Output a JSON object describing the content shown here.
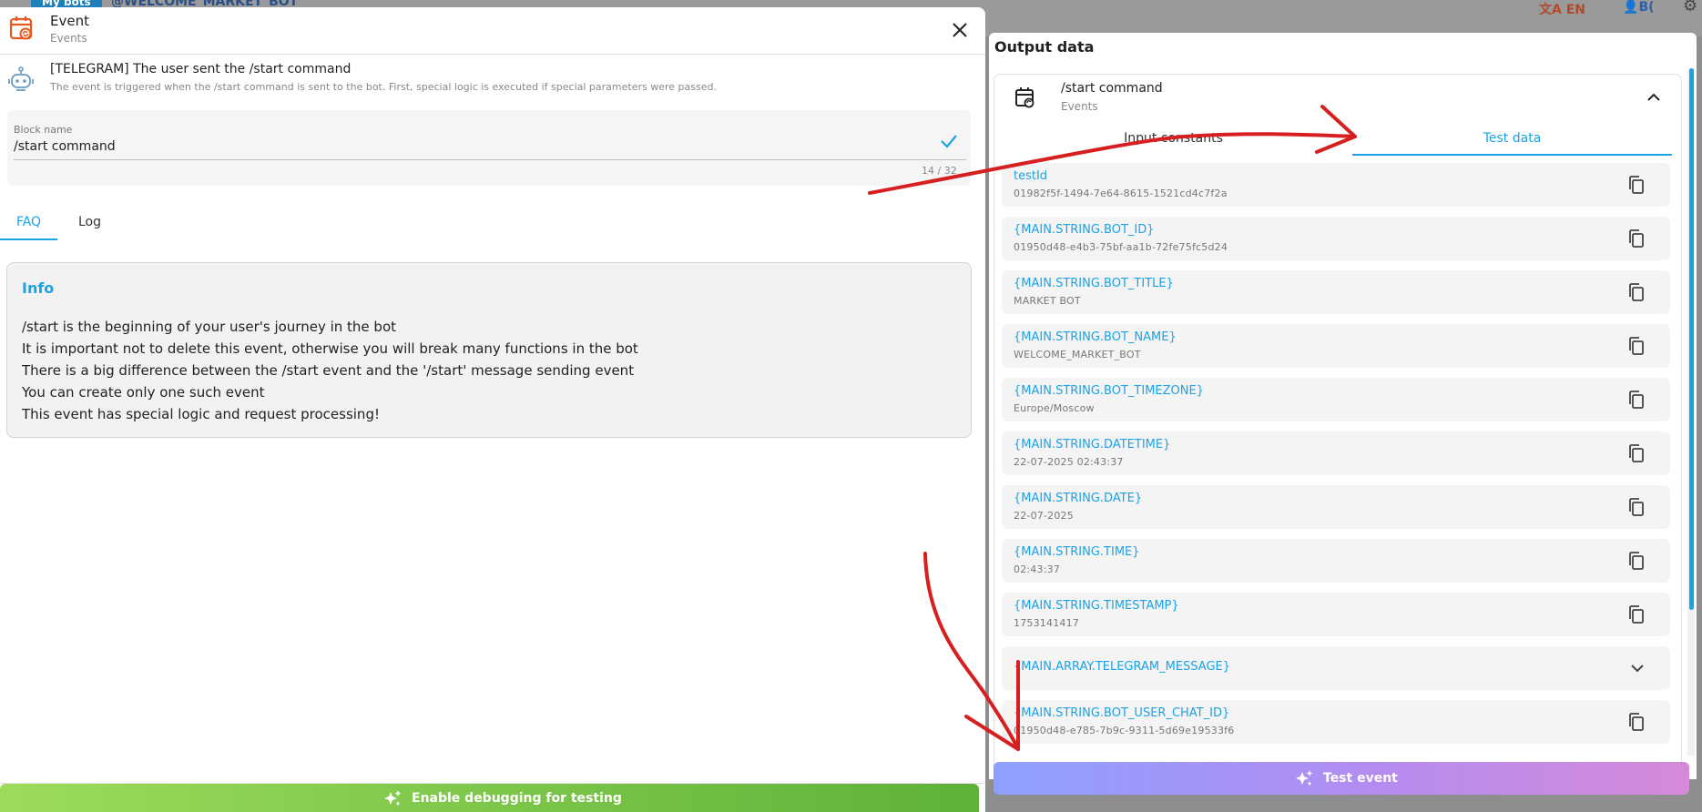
{
  "background": {
    "my_bots": "My bots",
    "bot_handle": "@WELCOME_MARKET_BOT",
    "language": "EN",
    "user": "B("
  },
  "event_panel": {
    "title": "Event",
    "subtitle": "Events",
    "trigger_title": "[TELEGRAM] The user sent the /start command",
    "trigger_description": "The event is triggered when the /start command is sent to the bot. First, special logic is executed if special parameters were passed.",
    "block_name_label": "Block name",
    "block_name_value": "/start command",
    "char_counter": "14 / 32",
    "tabs": {
      "faq": "FAQ",
      "log": "Log"
    },
    "info": {
      "title": "Info",
      "lines": [
        "/start is the beginning of your user's journey in the bot",
        "It is important not to delete this event, otherwise you will break many functions in the bot",
        "There is a big difference between the /start event and the '/start' message sending event",
        "You can create only one such event",
        "This event has special logic and request processing!"
      ]
    },
    "debug_button": "Enable debugging for testing"
  },
  "output_panel": {
    "title": "Output data",
    "card_title": "/start command",
    "card_subtitle": "Events",
    "tabs": {
      "input": "Input constants",
      "test": "Test data"
    },
    "items": [
      {
        "name": "testId",
        "value": "01982f5f-1494-7e64-8615-1521cd4c7f2a"
      },
      {
        "name": "{MAIN.STRING.BOT_ID}",
        "value": "01950d48-e4b3-75bf-aa1b-72fe75fc5d24"
      },
      {
        "name": "{MAIN.STRING.BOT_TITLE}",
        "value": "MARKET BOT"
      },
      {
        "name": "{MAIN.STRING.BOT_NAME}",
        "value": "WELCOME_MARKET_BOT"
      },
      {
        "name": "{MAIN.STRING.BOT_TIMEZONE}",
        "value": "Europe/Moscow"
      },
      {
        "name": "{MAIN.STRING.DATETIME}",
        "value": "22-07-2025 02:43:37"
      },
      {
        "name": "{MAIN.STRING.DATE}",
        "value": "22-07-2025"
      },
      {
        "name": "{MAIN.STRING.TIME}",
        "value": "02:43:37"
      },
      {
        "name": "{MAIN.STRING.TIMESTAMP}",
        "value": "1753141417"
      },
      {
        "name": "{MAIN.ARRAY.TELEGRAM_MESSAGE}",
        "value": ""
      },
      {
        "name": "{MAIN.STRING.BOT_USER_CHAT_ID}",
        "value": "01950d48-e785-7b9c-9311-5d69e19533f6"
      }
    ],
    "test_button": "Test event"
  },
  "colors": {
    "accent": "#1aa3e8",
    "annotation": "#d81f1f",
    "event_icon": "#e8571f"
  }
}
